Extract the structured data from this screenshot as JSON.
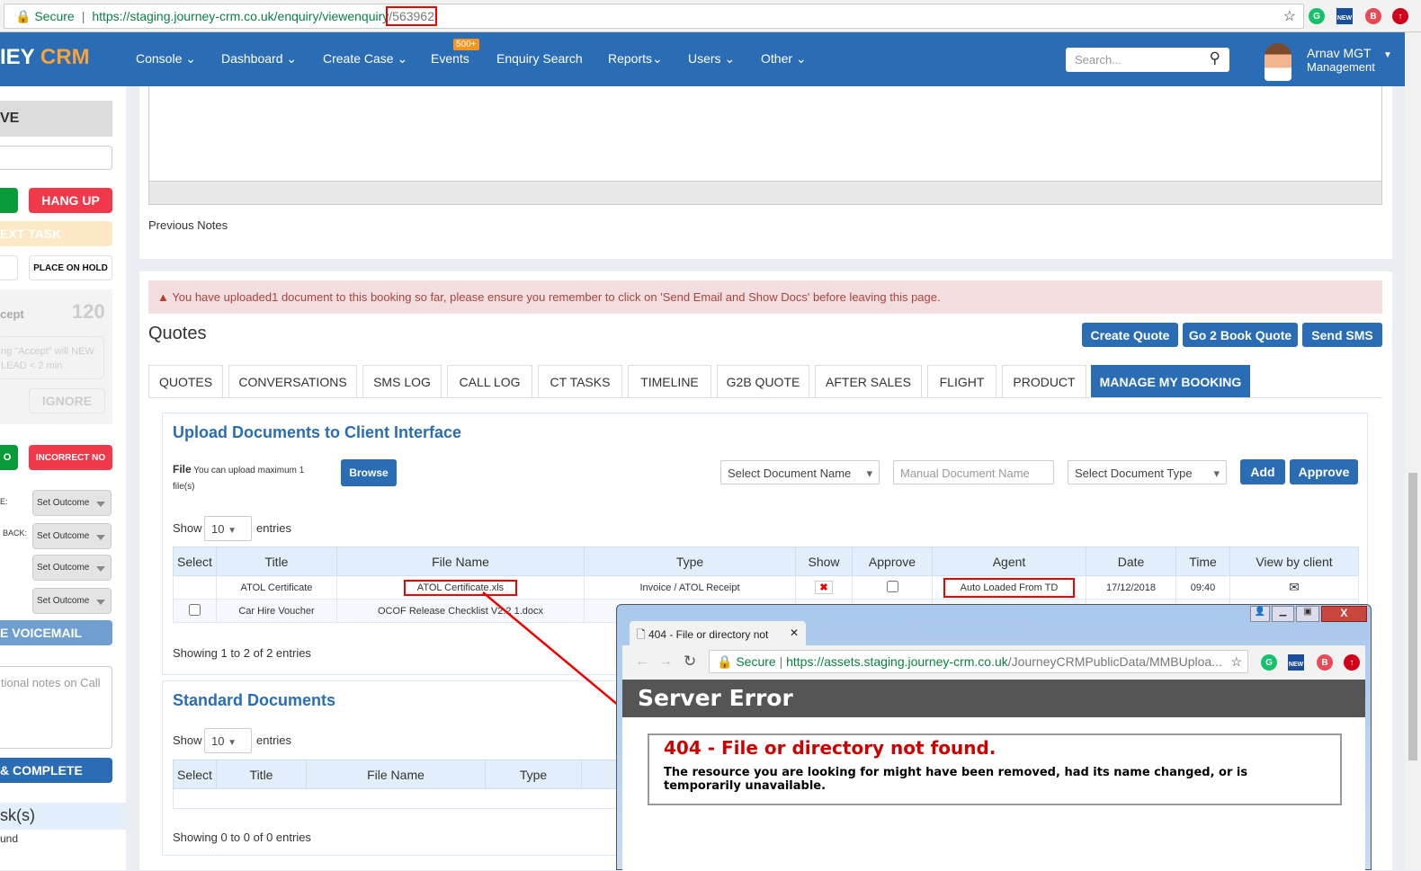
{
  "browser": {
    "secure": "Secure",
    "url_base": "https://staging.journey-crm.co.uk/enquiry/viewenquiry",
    "url_id": "/563962"
  },
  "nav": {
    "logo_a": "IEY",
    "logo_b": "CRM",
    "items": [
      "Console",
      "Dashboard",
      "Create Case",
      "Events",
      "Enquiry Search",
      "Reports",
      "Users",
      "Other"
    ],
    "events_badge": "500+",
    "search_placeholder": "Search...",
    "user_name": "Arnav MGT",
    "user_role": "Management"
  },
  "sidebar": {
    "header": "VE",
    "hang_up": "HANG UP",
    "next_task": "EXT TASK",
    "place_on_hold": "PLACE ON HOLD",
    "accept_label": "cept",
    "countdown": "120",
    "accept_note": "ng \"Accept\" will NEW LEAD < 2 min",
    "ignore": "IGNORE",
    "incorrect_no": "INCORRECT NO",
    "green_btn2": "O",
    "outcome_label1": "E:",
    "outcome_label2": "BACK:",
    "set_outcome": "Set Outcome",
    "voicemail": "E VOICEMAIL",
    "notes_placeholder": "tional notes on Call",
    "complete": "& COMPLETE",
    "tasks_title": "sk(s)",
    "tasks_note": "und"
  },
  "notes": {
    "previous_notes": "Previous Notes"
  },
  "alert": "You have uploaded1 document to this booking so far, please ensure you remember to click on 'Send Email and Show Docs' before leaving this page.",
  "quotes": {
    "title": "Quotes",
    "buttons": [
      "Create Quote",
      "Go 2 Book Quote",
      "Send SMS"
    ],
    "tabs": [
      "QUOTES",
      "CONVERSATIONS",
      "SMS LOG",
      "CALL LOG",
      "CT TASKS",
      "TIMELINE",
      "G2B QUOTE",
      "AFTER SALES",
      "FLIGHT",
      "PRODUCT",
      "MANAGE MY BOOKING"
    ],
    "active_tab": "MANAGE MY BOOKING"
  },
  "upload": {
    "title": "Upload Documents to Client Interface",
    "file_label": "File",
    "file_note": "You can upload maximum 1 file(s)",
    "browse": "Browse",
    "doc_name_select": "Select Document Name",
    "manual_name_placeholder": "Manual Document Name",
    "doc_type_select": "Select Document Type",
    "add": "Add",
    "approve": "Approve",
    "show": "Show",
    "entries_count": "10",
    "entries": "entries",
    "columns": [
      "Select",
      "Title",
      "File Name",
      "Type",
      "Show",
      "Approve",
      "Agent",
      "Date",
      "Time",
      "View by client"
    ],
    "rows": [
      {
        "title": "ATOL Certificate",
        "file": "ATOL Certificate.xls",
        "type": "Invoice / ATOL Receipt",
        "agent": "Auto Loaded From TD",
        "date": "17/12/2018",
        "time": "09:40"
      },
      {
        "title": "Car Hire Voucher",
        "file": "OCOF Release Checklist V2.2 1.docx"
      }
    ],
    "footer": "Showing 1 to 2 of 2 entries"
  },
  "standard": {
    "title": "Standard Documents",
    "show": "Show",
    "entries_count": "10",
    "entries": "entries",
    "columns": [
      "Select",
      "Title",
      "File Name",
      "Type"
    ],
    "footer": "Showing 0 to 0 of 0 entries"
  },
  "popup": {
    "tab_title": "404 - File or directory not",
    "secure": "Secure",
    "url_base": "https://assets.staging.journey-crm.co.uk",
    "url_path": "/JourneyCRMPublicData/MMBUploa...",
    "header": "Server Error",
    "error_title": "404 - File or directory not found.",
    "error_text": "The resource you are looking for might have been removed, had its name changed, or is temporarily unavailable."
  },
  "colors": {
    "brand": "#2a6db5",
    "danger": "#f0394a",
    "success": "#0a9a3a",
    "alert_bg": "#f2dede",
    "error_red": "#cc0000"
  }
}
